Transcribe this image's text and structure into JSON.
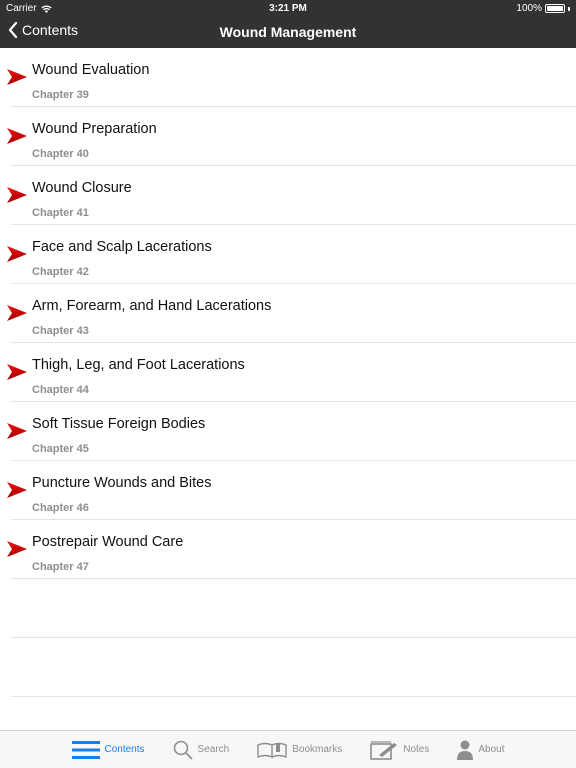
{
  "status_bar": {
    "carrier": "Carrier",
    "time": "3:21 PM",
    "battery": "100%"
  },
  "nav": {
    "back_label": "Contents",
    "title": "Wound Management"
  },
  "chapters": [
    {
      "title": "Wound Evaluation",
      "chapter": "Chapter 39"
    },
    {
      "title": "Wound Preparation",
      "chapter": "Chapter 40"
    },
    {
      "title": "Wound Closure",
      "chapter": "Chapter 41"
    },
    {
      "title": "Face and Scalp Lacerations",
      "chapter": "Chapter 42"
    },
    {
      "title": "Arm, Forearm, and Hand Lacerations",
      "chapter": "Chapter 43"
    },
    {
      "title": "Thigh, Leg, and Foot Lacerations",
      "chapter": "Chapter 44"
    },
    {
      "title": "Soft Tissue Foreign Bodies",
      "chapter": "Chapter 45"
    },
    {
      "title": "Puncture Wounds and Bites",
      "chapter": "Chapter 46"
    },
    {
      "title": "Postrepair Wound Care",
      "chapter": "Chapter 47"
    }
  ],
  "tabbar": {
    "tabs": [
      {
        "label": "Contents",
        "icon": "list-icon",
        "active": true
      },
      {
        "label": "Search",
        "icon": "search-icon",
        "active": false
      },
      {
        "label": "Bookmarks",
        "icon": "book-icon",
        "active": false
      },
      {
        "label": "Notes",
        "icon": "notes-icon",
        "active": false
      },
      {
        "label": "About",
        "icon": "person-icon",
        "active": false
      }
    ]
  },
  "colors": {
    "header_bg": "#323232",
    "accent": "#1a7df0",
    "arrow_red": "#d40000",
    "inactive": "#8e8e8e"
  }
}
